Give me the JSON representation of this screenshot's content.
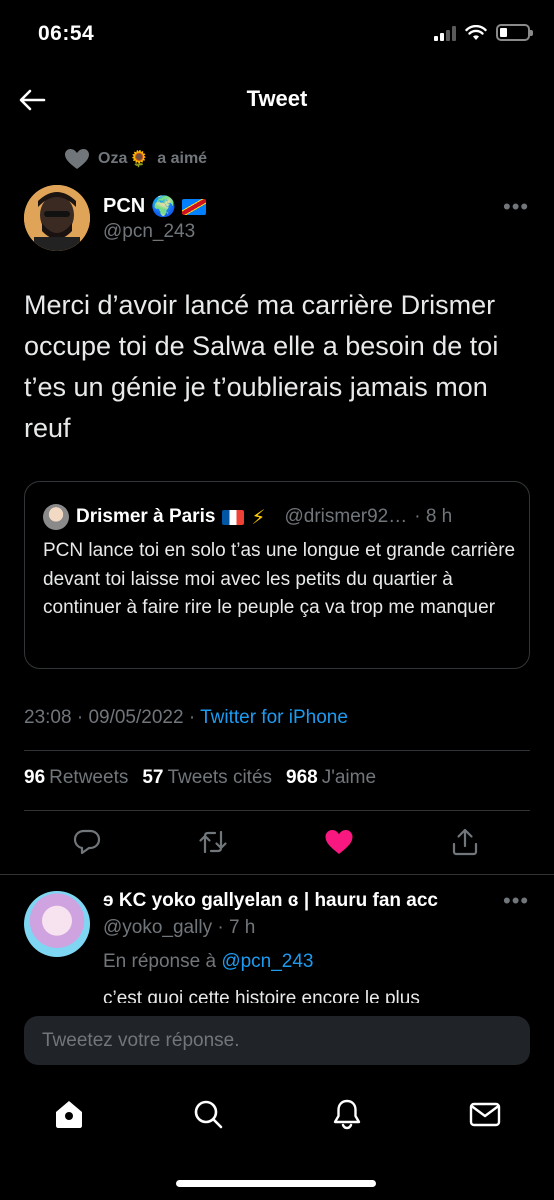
{
  "status_bar": {
    "time": "06:54"
  },
  "header": {
    "title": "Tweet",
    "back_icon": "arrow-left-icon"
  },
  "liked_by": {
    "name": "Oza",
    "emoji": "🌻",
    "action": "a aimé"
  },
  "tweet": {
    "author_name": "PCN",
    "author_emoji": "🌍",
    "author_handle": "@pcn_243",
    "more_label": "•••",
    "text": "Merci d’avoir lancé ma carrière Drismer occupe toi de Salwa elle a besoin de toi t’es un génie je t’oublierais jamais mon reuf",
    "quote": {
      "name": "Drismer à Paris",
      "bolt": "⚡",
      "handle": "@drismer92…",
      "time": "· 8 h",
      "text": "PCN lance toi en solo t’as une longue et grande carrière devant toi laisse moi avec les petits du quartier à continuer à faire rire le peuple ça va trop me manquer"
    },
    "time": "23:08",
    "date": "09/05/2022",
    "separator": "·",
    "source": "Twitter for iPhone",
    "stats": {
      "retweets_count": "96",
      "retweets_label": "Retweets",
      "quotes_count": "57",
      "quotes_label": "Tweets cités",
      "likes_count": "968",
      "likes_label": "J'aime"
    },
    "colors": {
      "like_active": "#f91880",
      "link": "#1d9bf0"
    }
  },
  "reply": {
    "name": "ɘ KC yoko gallyelan ɞ | hauru fan acc",
    "handle": "@yoko_gally",
    "time": "· 7 h",
    "more_label": "•••",
    "reply_to_label": "En réponse à",
    "reply_to_mention": "@pcn_243",
    "text": "c’est quoi cette histoire encore le plus"
  },
  "compose": {
    "placeholder": "Tweetez votre réponse."
  },
  "tabbar": {
    "icons": [
      "home-icon",
      "search-icon",
      "bell-icon",
      "mail-icon"
    ]
  }
}
